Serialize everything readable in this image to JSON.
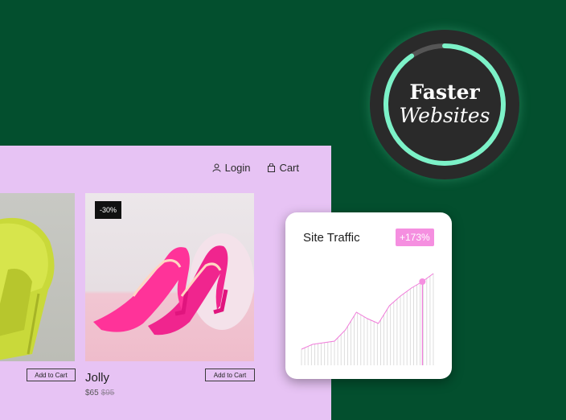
{
  "badge": {
    "line1": "Faster",
    "line2": "Websites",
    "ring_color": "#7cf2c8"
  },
  "nav": {
    "login": "Login",
    "cart": "Cart"
  },
  "products": [
    {
      "add_label": "Add to Cart"
    },
    {
      "name": "Jolly",
      "price": "$65",
      "old_price": "$95",
      "discount": "-30%",
      "add_label": "Add to Cart"
    }
  ],
  "traffic": {
    "title": "Site Traffic",
    "change": "+173%",
    "accent": "#f58fe0"
  },
  "chart_data": {
    "type": "area",
    "values": [
      20,
      26,
      28,
      30,
      44,
      66,
      58,
      52,
      74,
      86,
      96,
      104,
      114
    ],
    "highlight_index": 11,
    "ylim": [
      0,
      130
    ]
  }
}
